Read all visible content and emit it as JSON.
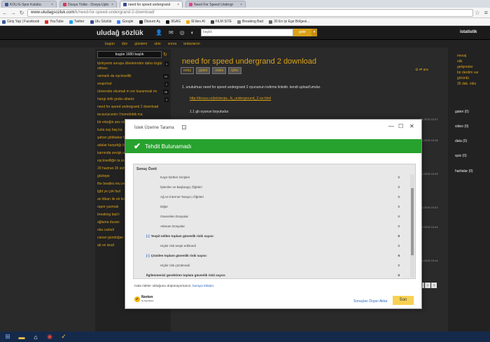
{
  "browser": {
    "tabs": [
      {
        "label": "KOU E-Spor Kulübü",
        "color": "#3b5998"
      },
      {
        "label": "Dosya Yükle - Dosya Uplo",
        "color": "#d23c5b"
      },
      {
        "label": "need for speed undergrand",
        "color": "#394a93"
      },
      {
        "label": "Need For Speed Undergr",
        "color": "#e0478a"
      }
    ],
    "url_host": "www.uludagsozluk.com",
    "url_path": "/k/need-for-speed-undergrand-2-download/",
    "bookmarks": [
      {
        "label": "Giriş Yap | Facebook",
        "color": "#3b5998"
      },
      {
        "label": "YouTube",
        "color": "#e02d2d"
      },
      {
        "label": "Twitter",
        "color": "#1da1f2"
      },
      {
        "label": "Ulu Sözlük",
        "color": "#3b4c8e"
      },
      {
        "label": "Google",
        "color": "#4285f4"
      },
      {
        "label": "Oturum Aç",
        "color": "#2b2b2b"
      },
      {
        "label": "9GAG",
        "color": "#111111"
      },
      {
        "label": "IE'den Al",
        "color": "#f0ad00"
      },
      {
        "label": "FiLM SiTE",
        "color": "#444444"
      },
      {
        "label": "Breaking Bad",
        "color": "#888888"
      },
      {
        "label": "30 En iyi Ege Bölgesi...",
        "color": "#6a6a6a"
      }
    ]
  },
  "site": {
    "logo": "uludağ sözlük",
    "search_placeholder": "başlık",
    "search_button": "getir",
    "right_link": "istatistik",
    "nav": [
      "bugün",
      "dün",
      "gündem",
      "ukte",
      "sonra",
      "tedaviarım"
    ],
    "today_count": "bugün 1680 başlık",
    "left_topics": [
      {
        "title": "türkiyenin avrupa ülkelerinden daha özgür olması",
        "count": "3"
      },
      {
        "title": "osmanlı da eşcinsellik",
        "count": "33"
      },
      {
        "title": "snapchat",
        "count": "2"
      },
      {
        "title": "üniversite okumak m zor kazanmak mı",
        "count": "36"
      },
      {
        "title": "hangi strik grubu altaniz",
        "count": "3"
      },
      {
        "title": "need for speed undergrand 2 download",
        "count": ""
      },
      {
        "title": "tecavüzcenin l homofobik ma",
        "count": ""
      },
      {
        "title": "bir erkeğin ans olmak",
        "count": ""
      },
      {
        "title": "kızla saç baş ka",
        "count": ""
      },
      {
        "title": "şahan gökbakar türkistan mezi",
        "count": ""
      },
      {
        "title": "adalar karşıdığı borcunu ödem",
        "count": ""
      },
      {
        "title": "karnında sevişk alan erkek",
        "count": ""
      },
      {
        "title": "eşcinselliğin ta arayışı olması",
        "count": ""
      },
      {
        "title": "29 haziran 20 sütyensiz gezm",
        "count": ""
      },
      {
        "title": "göztepe",
        "count": ""
      },
      {
        "title": "the beatles mu zeppelin mi",
        "count": ""
      },
      {
        "title": "lgbt ye çok fazl",
        "count": ""
      },
      {
        "title": "an itibarı ile ek bozulması",
        "count": ""
      },
      {
        "title": "rapor yazmak",
        "count": ""
      },
      {
        "title": "breaking bad t",
        "count": ""
      },
      {
        "title": "ağlama duvarı",
        "count": ""
      },
      {
        "title": "oka cadıeli",
        "count": ""
      },
      {
        "title": "canan gündoğan ın çok sebsi olması",
        "count": "2"
      },
      {
        "title": "ab ve israil",
        "count": ""
      }
    ],
    "page_title": "need for speed undergrand 2 download",
    "content_tabs": [
      "entry",
      "galeri",
      "video",
      "tyller"
    ],
    "tools_label": "ara",
    "entry_text": "1.   unutulmaz need for speed undergrand 2 oyununun indirme linkidir. kendi upload'umdur.",
    "entry_link": "http://dosya.co/jxtctwcjw...fs_underground_2.rar.html",
    "entry_size": "1.1 gb oyunun boyutudur.",
    "timestamps": [
      "06.2015 15:37",
      "06.2015 15:38",
      "06.2015 15:39",
      "06.2015 15:42",
      "06.2015 15:44",
      "06.2015 15:44"
    ],
    "right_top": [
      "mesaj",
      "olik",
      "gelişmeler",
      "bir derdim var",
      "görüntü",
      "36 dak. oldu"
    ],
    "right_sections": [
      "galeri (0)",
      "video (0)",
      "data (0)",
      "quiz (0)",
      "haritalar (0)"
    ],
    "pager": [
      "4",
      "1",
      "1"
    ]
  },
  "dialog": {
    "title": "İstek Üzerine Tarama",
    "help": "?",
    "banner": "Tehdit Bulunamadı",
    "summary_header": "Sonuç Özeti",
    "rows": [
      {
        "label": "Kayıt Defteri Girişleri",
        "value": "0",
        "bold": false,
        "plus": false,
        "indent": 38
      },
      {
        "label": "İşlemler ve Başlangıç Öğeleri",
        "value": "0",
        "bold": false,
        "plus": false,
        "indent": 38
      },
      {
        "label": "Ağ ve İnternet Tarayıcı Öğeleri",
        "value": "0",
        "bold": false,
        "plus": false,
        "indent": 38
      },
      {
        "label": "Diğer",
        "value": "0",
        "bold": false,
        "plus": false,
        "indent": 38
      },
      {
        "label": "Güvenilen Dosyalar",
        "value": "0",
        "bold": false,
        "plus": false,
        "indent": 38
      },
      {
        "label": "Atlanan Dosyalar",
        "value": "0",
        "bold": false,
        "plus": false,
        "indent": 38
      },
      {
        "label": "Tespit edilen toplam güvenlik riski sayısı:",
        "value": "0",
        "bold": true,
        "plus": true,
        "indent": 18
      },
      {
        "label": "Hiçbir risk tespit edilmedi",
        "value": "0",
        "bold": false,
        "plus": false,
        "indent": 38
      },
      {
        "label": "Çözülen toplam güvenlik riski sayısı:",
        "value": "0",
        "bold": true,
        "plus": true,
        "indent": 18
      },
      {
        "label": "Hiçbir risk çözülmedi",
        "value": "0",
        "bold": false,
        "plus": false,
        "indent": 38
      },
      {
        "label": "İlgilenmenizi gerektiren toplam güvenlik riski sayısı:",
        "value": "0",
        "bold": true,
        "plus": false,
        "indent": 18
      }
    ],
    "footer_text": "Hala riskler olduğunu düşünüyorsanız,",
    "footer_link": "buraya tıklatın",
    "footer_period": ".",
    "brand": "Norton",
    "brand_sub": "by Symantec",
    "export_link": "Sonuçları Dışarı Aktar",
    "finish_button": "Son"
  },
  "colors": {
    "accent": "#d9a21a",
    "banner_green": "#27a22e",
    "finish_yellow": "#f7d154"
  }
}
